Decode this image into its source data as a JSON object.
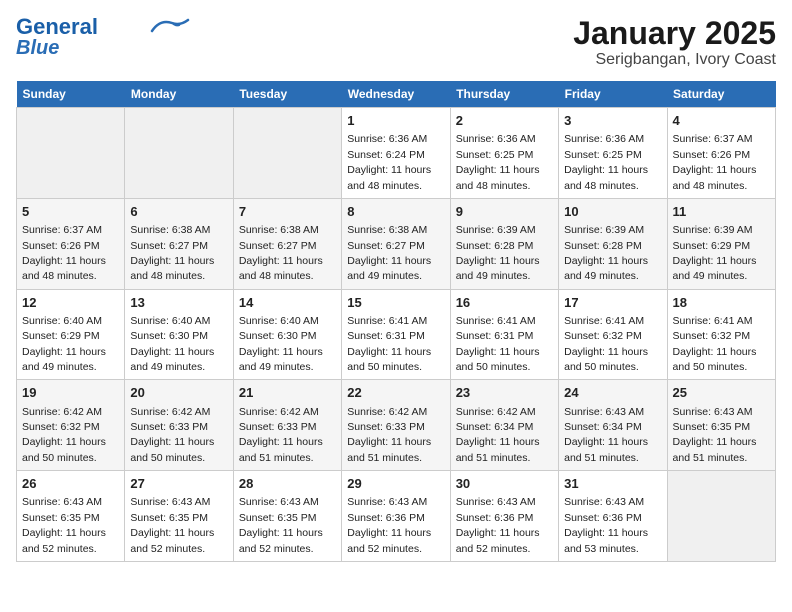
{
  "header": {
    "logo_line1": "General",
    "logo_line2": "Blue",
    "title": "January 2025",
    "subtitle": "Serigbangan, Ivory Coast"
  },
  "weekdays": [
    "Sunday",
    "Monday",
    "Tuesday",
    "Wednesday",
    "Thursday",
    "Friday",
    "Saturday"
  ],
  "weeks": [
    [
      {
        "day": "",
        "info": ""
      },
      {
        "day": "",
        "info": ""
      },
      {
        "day": "",
        "info": ""
      },
      {
        "day": "1",
        "info": "Sunrise: 6:36 AM\nSunset: 6:24 PM\nDaylight: 11 hours and 48 minutes."
      },
      {
        "day": "2",
        "info": "Sunrise: 6:36 AM\nSunset: 6:25 PM\nDaylight: 11 hours and 48 minutes."
      },
      {
        "day": "3",
        "info": "Sunrise: 6:36 AM\nSunset: 6:25 PM\nDaylight: 11 hours and 48 minutes."
      },
      {
        "day": "4",
        "info": "Sunrise: 6:37 AM\nSunset: 6:26 PM\nDaylight: 11 hours and 48 minutes."
      }
    ],
    [
      {
        "day": "5",
        "info": "Sunrise: 6:37 AM\nSunset: 6:26 PM\nDaylight: 11 hours and 48 minutes."
      },
      {
        "day": "6",
        "info": "Sunrise: 6:38 AM\nSunset: 6:27 PM\nDaylight: 11 hours and 48 minutes."
      },
      {
        "day": "7",
        "info": "Sunrise: 6:38 AM\nSunset: 6:27 PM\nDaylight: 11 hours and 48 minutes."
      },
      {
        "day": "8",
        "info": "Sunrise: 6:38 AM\nSunset: 6:27 PM\nDaylight: 11 hours and 49 minutes."
      },
      {
        "day": "9",
        "info": "Sunrise: 6:39 AM\nSunset: 6:28 PM\nDaylight: 11 hours and 49 minutes."
      },
      {
        "day": "10",
        "info": "Sunrise: 6:39 AM\nSunset: 6:28 PM\nDaylight: 11 hours and 49 minutes."
      },
      {
        "day": "11",
        "info": "Sunrise: 6:39 AM\nSunset: 6:29 PM\nDaylight: 11 hours and 49 minutes."
      }
    ],
    [
      {
        "day": "12",
        "info": "Sunrise: 6:40 AM\nSunset: 6:29 PM\nDaylight: 11 hours and 49 minutes."
      },
      {
        "day": "13",
        "info": "Sunrise: 6:40 AM\nSunset: 6:30 PM\nDaylight: 11 hours and 49 minutes."
      },
      {
        "day": "14",
        "info": "Sunrise: 6:40 AM\nSunset: 6:30 PM\nDaylight: 11 hours and 49 minutes."
      },
      {
        "day": "15",
        "info": "Sunrise: 6:41 AM\nSunset: 6:31 PM\nDaylight: 11 hours and 50 minutes."
      },
      {
        "day": "16",
        "info": "Sunrise: 6:41 AM\nSunset: 6:31 PM\nDaylight: 11 hours and 50 minutes."
      },
      {
        "day": "17",
        "info": "Sunrise: 6:41 AM\nSunset: 6:32 PM\nDaylight: 11 hours and 50 minutes."
      },
      {
        "day": "18",
        "info": "Sunrise: 6:41 AM\nSunset: 6:32 PM\nDaylight: 11 hours and 50 minutes."
      }
    ],
    [
      {
        "day": "19",
        "info": "Sunrise: 6:42 AM\nSunset: 6:32 PM\nDaylight: 11 hours and 50 minutes."
      },
      {
        "day": "20",
        "info": "Sunrise: 6:42 AM\nSunset: 6:33 PM\nDaylight: 11 hours and 50 minutes."
      },
      {
        "day": "21",
        "info": "Sunrise: 6:42 AM\nSunset: 6:33 PM\nDaylight: 11 hours and 51 minutes."
      },
      {
        "day": "22",
        "info": "Sunrise: 6:42 AM\nSunset: 6:33 PM\nDaylight: 11 hours and 51 minutes."
      },
      {
        "day": "23",
        "info": "Sunrise: 6:42 AM\nSunset: 6:34 PM\nDaylight: 11 hours and 51 minutes."
      },
      {
        "day": "24",
        "info": "Sunrise: 6:43 AM\nSunset: 6:34 PM\nDaylight: 11 hours and 51 minutes."
      },
      {
        "day": "25",
        "info": "Sunrise: 6:43 AM\nSunset: 6:35 PM\nDaylight: 11 hours and 51 minutes."
      }
    ],
    [
      {
        "day": "26",
        "info": "Sunrise: 6:43 AM\nSunset: 6:35 PM\nDaylight: 11 hours and 52 minutes."
      },
      {
        "day": "27",
        "info": "Sunrise: 6:43 AM\nSunset: 6:35 PM\nDaylight: 11 hours and 52 minutes."
      },
      {
        "day": "28",
        "info": "Sunrise: 6:43 AM\nSunset: 6:35 PM\nDaylight: 11 hours and 52 minutes."
      },
      {
        "day": "29",
        "info": "Sunrise: 6:43 AM\nSunset: 6:36 PM\nDaylight: 11 hours and 52 minutes."
      },
      {
        "day": "30",
        "info": "Sunrise: 6:43 AM\nSunset: 6:36 PM\nDaylight: 11 hours and 52 minutes."
      },
      {
        "day": "31",
        "info": "Sunrise: 6:43 AM\nSunset: 6:36 PM\nDaylight: 11 hours and 53 minutes."
      },
      {
        "day": "",
        "info": ""
      }
    ]
  ]
}
